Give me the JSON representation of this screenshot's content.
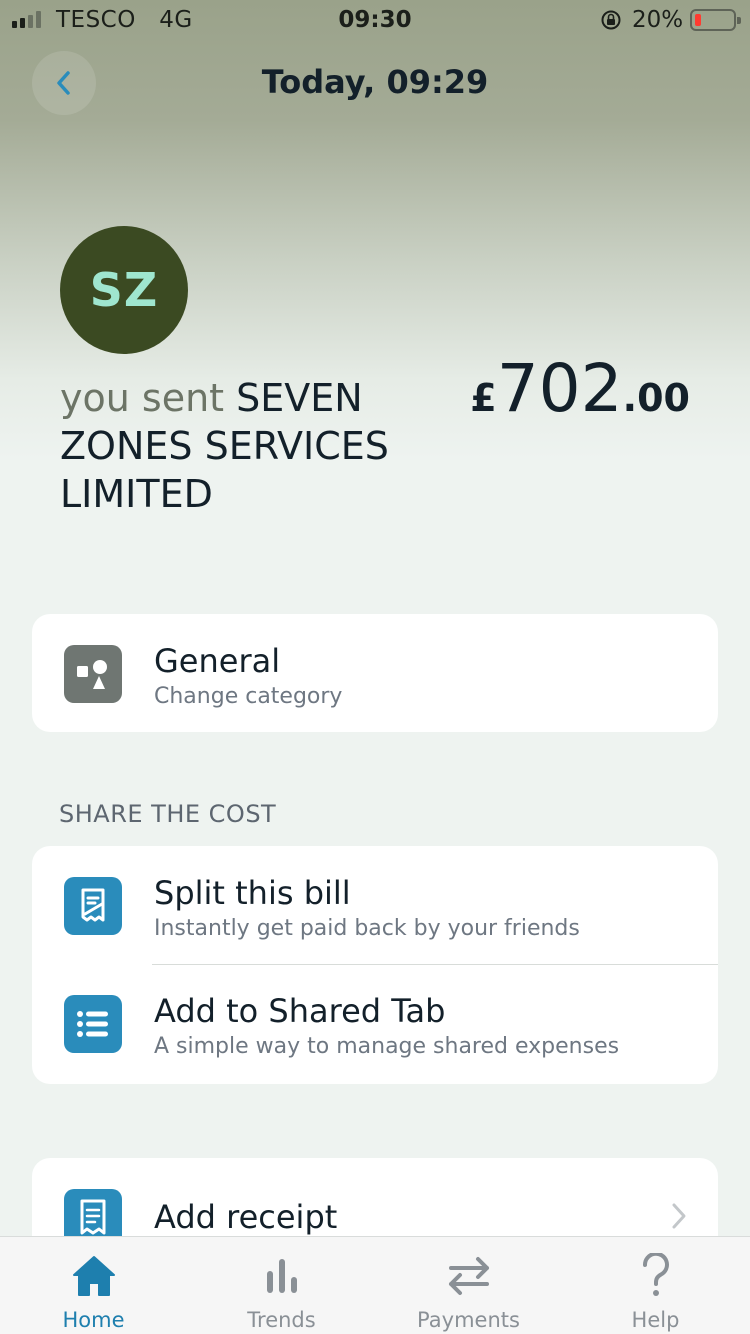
{
  "status_bar": {
    "carrier": "TESCO",
    "network": "4G",
    "time": "09:30",
    "battery": "20%",
    "battery_level": 0.2,
    "battery_color": "#ff3b30"
  },
  "header": {
    "title": "Today, 09:29",
    "back_icon": "chevron-left-icon"
  },
  "transaction": {
    "avatar_initials": "SZ",
    "lead_text": "you sent",
    "merchant": "SEVEN ZONES SERVICES LIMITED",
    "currency": "£",
    "amount_whole": "702",
    "amount_fraction": ".00"
  },
  "category_card": {
    "title": "General",
    "subtitle": "Change category",
    "icon": "shapes-icon",
    "icon_color": "#6f7672"
  },
  "share_section": {
    "label": "SHARE THE COST",
    "items": [
      {
        "title": "Split this bill",
        "subtitle": "Instantly get paid back by your friends",
        "icon": "split-bill-icon"
      },
      {
        "title": "Add to Shared Tab",
        "subtitle": "A simple way to manage shared expenses",
        "icon": "list-icon"
      }
    ],
    "icon_color": "#2a8cbb"
  },
  "receipt_card": {
    "title": "Add receipt",
    "icon": "receipt-icon"
  },
  "tab_bar": {
    "tabs": [
      {
        "label": "Home",
        "icon": "home-icon",
        "active": true
      },
      {
        "label": "Trends",
        "icon": "bar-chart-icon",
        "active": false
      },
      {
        "label": "Payments",
        "icon": "transfer-arrows-icon",
        "active": false
      },
      {
        "label": "Help",
        "icon": "question-icon",
        "active": false
      }
    ],
    "active_color": "#1e7fae",
    "inactive_color": "#8a9096"
  }
}
